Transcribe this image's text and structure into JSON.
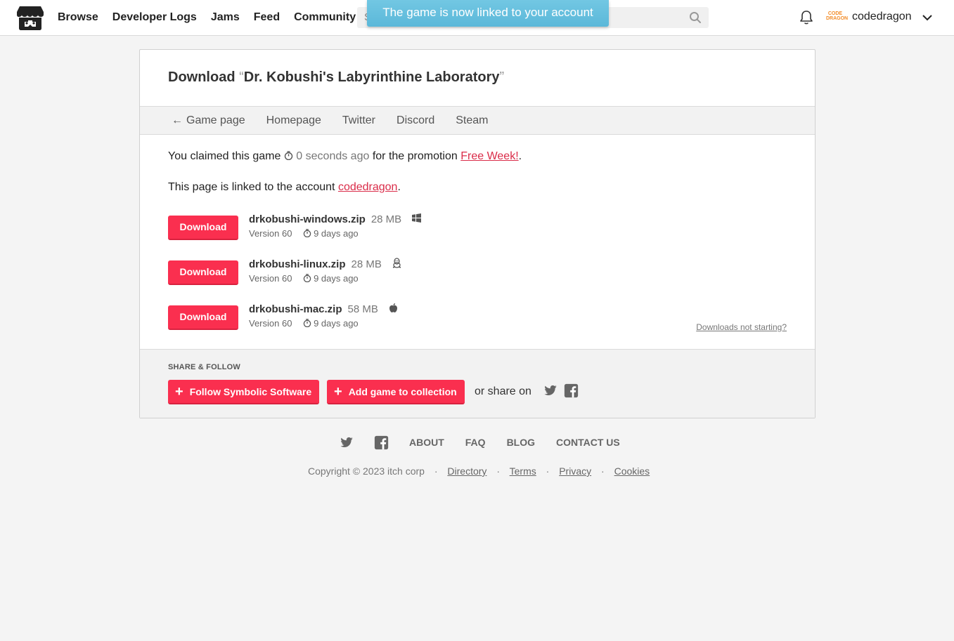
{
  "header": {
    "nav": [
      "Browse",
      "Developer Logs",
      "Jams",
      "Feed",
      "Community"
    ],
    "search_placeholder": "S",
    "toast": "The game is now linked to your account",
    "username": "codedragon",
    "avatar_text_line1": "CODE",
    "avatar_text_line2": "DRAGON"
  },
  "page": {
    "title_prefix": "Download ",
    "title_open_quote": "“",
    "title_game": "Dr. Kobushi's Labyrinthine Laboratory",
    "title_close_quote": "”",
    "subnav": {
      "back_arrow": "←",
      "game_page": "Game page",
      "homepage": "Homepage",
      "twitter": "Twitter",
      "discord": "Discord",
      "steam": "Steam"
    },
    "claimed": {
      "prefix": "You claimed this game",
      "time": "0 seconds ago",
      "middle": "for the promotion",
      "promo": "Free Week!",
      "suffix": "."
    },
    "linked": {
      "prefix": "This page is linked to the account",
      "account": "codedragon",
      "suffix": "."
    },
    "downloads": [
      {
        "button": "Download",
        "file": "drkobushi-windows.zip",
        "size": "28 MB",
        "os_icon": "windows-icon",
        "version": "Version 60",
        "age": "9 days ago"
      },
      {
        "button": "Download",
        "file": "drkobushi-linux.zip",
        "size": "28 MB",
        "os_icon": "linux-icon",
        "version": "Version 60",
        "age": "9 days ago"
      },
      {
        "button": "Download",
        "file": "drkobushi-mac.zip",
        "size": "58 MB",
        "os_icon": "apple-icon",
        "version": "Version 60",
        "age": "9 days ago"
      }
    ],
    "not_starting": "Downloads not starting?",
    "share": {
      "label": "SHARE & FOLLOW",
      "follow_button": "Follow Symbolic Software",
      "collection_button": "Add game to collection",
      "or_share": "or share on"
    }
  },
  "footer": {
    "links": [
      "ABOUT",
      "FAQ",
      "BLOG",
      "CONTACT US"
    ],
    "copyright": "Copyright © 2023 itch corp",
    "legal": [
      "Directory",
      "Terms",
      "Privacy",
      "Cookies"
    ],
    "separator": "·"
  },
  "colors": {
    "accent": "#fa2f4f",
    "link": "#da2c49",
    "toast": "#5bb8d9"
  }
}
